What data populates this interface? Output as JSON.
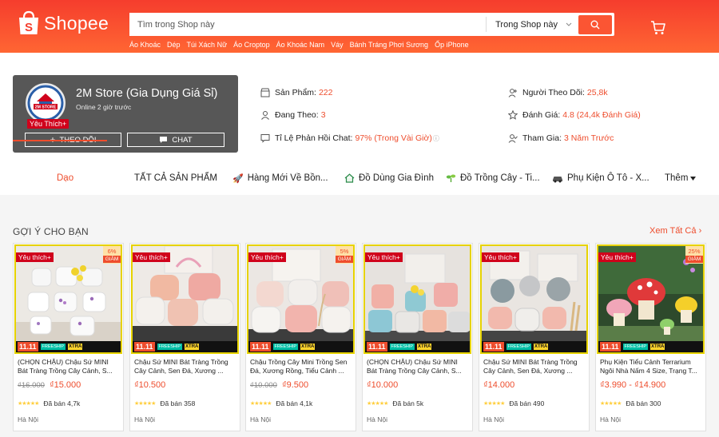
{
  "header": {
    "logo_text": "Shopee",
    "search_placeholder": "Tìm trong Shop này",
    "search_scope": "Trong Shop này",
    "hot_words": [
      "Áo Khoác",
      "Dép",
      "Túi Xách Nữ",
      "Áo Croptop",
      "Áo Khoác Nam",
      "Váy",
      "Bánh Tráng Phơi Sương",
      "Ốp iPhone"
    ],
    "brand_color": "#ee4d2d"
  },
  "shop": {
    "avatar_text": "2M STORE",
    "name": "2M Store (Gia Dụng Giá Sỉ)",
    "online": "Online 2 giờ trước",
    "favorite_badge": "Yêu Thích+",
    "follow_label": "THEO DÕI",
    "chat_label": "CHAT",
    "stats": {
      "products_label": "Sản Phẩm:",
      "products_value": "222",
      "following_label": "Đang Theo:",
      "following_value": "3",
      "response_label": "Tỉ Lệ Phản Hồi Chat:",
      "response_value": "97% (Trong Vài Giờ)",
      "followers_label": "Người Theo Dõi:",
      "followers_value": "25,8k",
      "rating_label": "Đánh Giá:",
      "rating_value": "4.8 (24,4k Đánh Giá)",
      "joined_label": "Tham Gia:",
      "joined_value": "3 Năm Trước"
    }
  },
  "tabs": {
    "t0": "Dạo",
    "t1": "TẤT CẢ SẢN PHẨM",
    "t2": "Hàng Mới Về Bồn...",
    "t3": "Đồ Dùng Gia Đình",
    "t4": "Đồ Trồng Cây - Ti...",
    "t5": "Phụ Kiện Ô Tô - X...",
    "more": "Thêm"
  },
  "section": {
    "title": "GỢI Ý CHO BẠN",
    "see_all": "Xem Tất Cả"
  },
  "products": [
    {
      "fav": "Yêu thích+",
      "discount": "6%",
      "discount_word": "GIẢM",
      "promo": "11.11",
      "freeship": "FREESHIP",
      "xtra": "XTRA",
      "name": "(CHỌN CHẬU) Chậu Sứ MINI Bát Tràng Trồng Cây Cảnh, S...",
      "old_price": "₫16.000",
      "price": "₫15.000",
      "sold": "Đã bán 4,7k",
      "location": "Hà Nội"
    },
    {
      "fav": "Yêu thích+",
      "discount": "",
      "discount_word": "",
      "promo": "11.11",
      "freeship": "FREESHIP",
      "xtra": "XTRA",
      "name": "Chậu Sứ MINI Bát Tràng Trồng Cây Cảnh, Sen Đá, Xương ...",
      "old_price": "",
      "price": "₫10.500",
      "sold": "Đã bán 358",
      "location": "Hà Nội"
    },
    {
      "fav": "Yêu thích+",
      "discount": "5%",
      "discount_word": "GIẢM",
      "promo": "11.11",
      "freeship": "FREESHIP",
      "xtra": "XTRA",
      "name": "Chậu Trồng Cây Mini Trồng Sen Đá, Xương Rồng, Tiểu Cảnh ...",
      "old_price": "₫10.000",
      "price": "₫9.500",
      "sold": "Đã bán 4,1k",
      "location": "Hà Nội"
    },
    {
      "fav": "Yêu thích+",
      "discount": "",
      "discount_word": "",
      "promo": "11.11",
      "freeship": "FREESHIP",
      "xtra": "XTRA",
      "name": "(CHỌN CHẬU) Chậu Sứ MINI Bát Tràng Trồng Cây Cảnh, S...",
      "old_price": "",
      "price": "₫10.000",
      "sold": "Đã bán 5k",
      "location": "Hà Nội"
    },
    {
      "fav": "Yêu thích+",
      "discount": "",
      "discount_word": "",
      "promo": "11.11",
      "freeship": "FREESHIP",
      "xtra": "XTRA",
      "name": "Chậu Sứ MINI Bát Tràng Trồng Cây Cảnh, Sen Đá, Xương ...",
      "old_price": "",
      "price": "₫14.000",
      "sold": "Đã bán 490",
      "location": "Hà Nội"
    },
    {
      "fav": "Yêu thích+",
      "discount": "25%",
      "discount_word": "GIẢM",
      "promo": "11.11",
      "freeship": "FREESHIP",
      "xtra": "XTRA",
      "name": "Phụ Kiện Tiểu Cảnh Terrarium Ngôi Nhà Nấm 4 Size, Trạng T...",
      "old_price": "",
      "price": "₫3.990 - ₫14.900",
      "sold": "Đã bán 300",
      "location": "Hà Nội"
    }
  ]
}
